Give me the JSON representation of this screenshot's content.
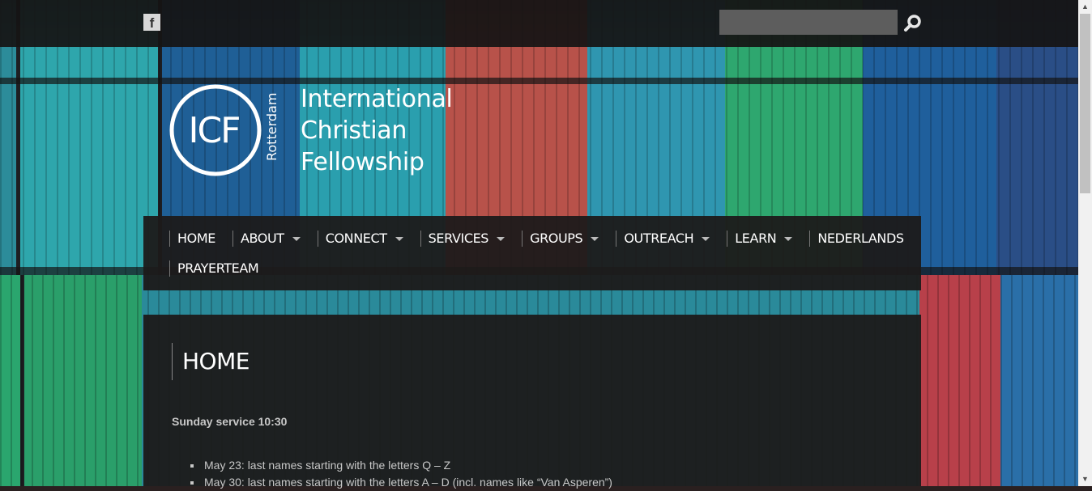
{
  "topbar": {
    "facebook_glyph": "f",
    "search": {
      "value": "",
      "placeholder": ""
    }
  },
  "logo": {
    "monogram": "ICF",
    "line1": "International",
    "line2": "Christian",
    "line3": "Fellowship",
    "city": "Rotterdam"
  },
  "nav": {
    "items": [
      {
        "label": "HOME",
        "has_menu": false
      },
      {
        "label": "ABOUT",
        "has_menu": true
      },
      {
        "label": "CONNECT",
        "has_menu": true
      },
      {
        "label": "SERVICES",
        "has_menu": true
      },
      {
        "label": "GROUPS",
        "has_menu": true
      },
      {
        "label": "OUTREACH",
        "has_menu": true
      },
      {
        "label": "LEARN",
        "has_menu": true
      },
      {
        "label": "NEDERLANDS",
        "has_menu": false
      },
      {
        "label": "PRAYERTEAM",
        "has_menu": false
      }
    ]
  },
  "content": {
    "title": "HOME",
    "service_heading": "Sunday service 10:30",
    "schedule": [
      "May 23:  last names starting with the letters Q – Z",
      "May 30: last names starting with the letters A – D (incl. names like “Van Asperen”)"
    ]
  },
  "colors": {
    "topbar_bg": "#161414",
    "panel_bg": "#1c1a1a",
    "search_bg": "#5d5d5d",
    "text_light": "#c8c8c8"
  },
  "icons": {
    "facebook": "facebook-icon",
    "search": "magnifier-icon",
    "submenu": "caret-down-icon"
  }
}
